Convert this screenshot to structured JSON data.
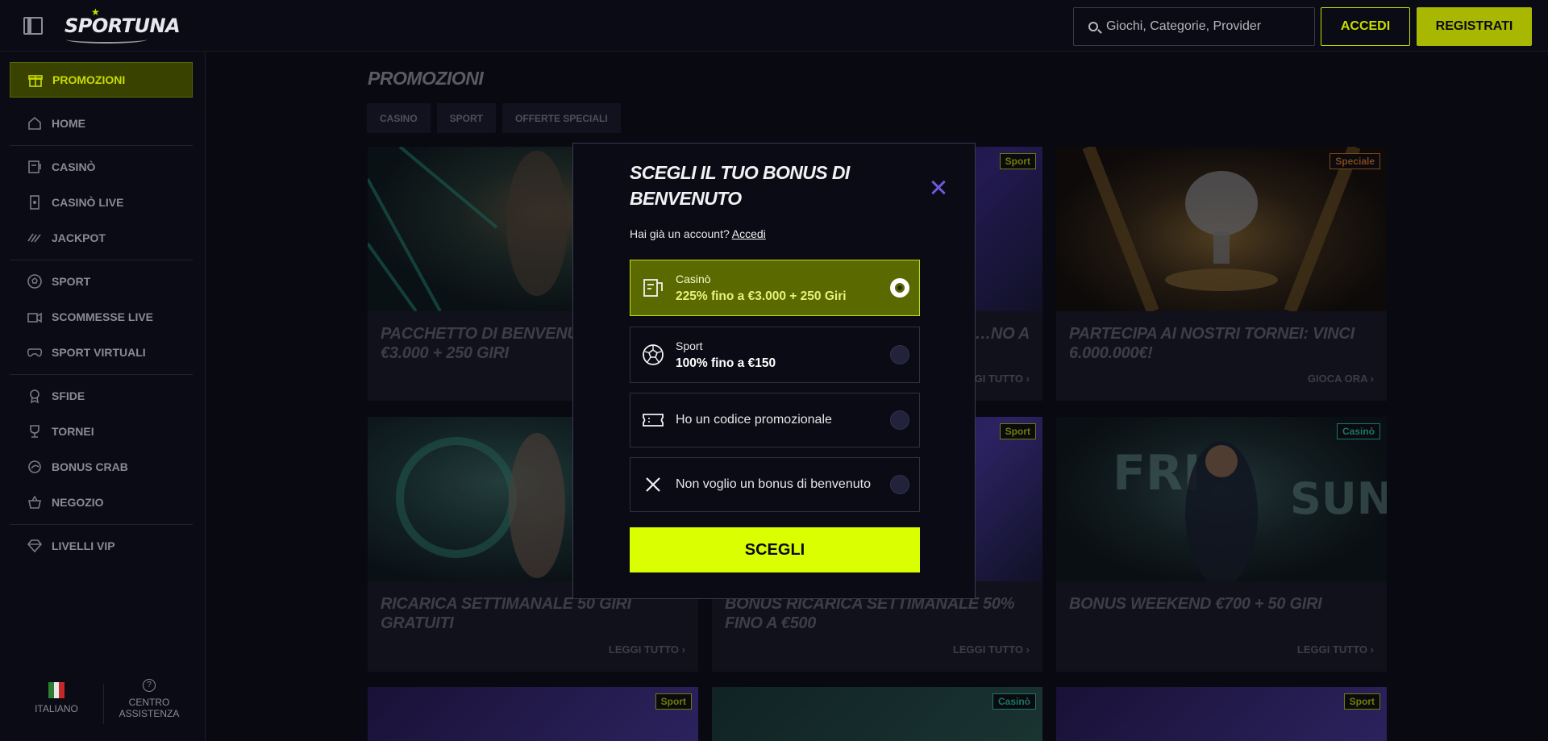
{
  "header": {
    "logo": "SPORTUNA",
    "search_placeholder": "Giochi, Categorie, Provider",
    "login_label": "ACCEDI",
    "register_label": "REGISTRATI"
  },
  "sidebar": {
    "items": [
      {
        "label": "PROMOZIONI",
        "icon": "gift-icon",
        "active": true
      },
      {
        "label": "HOME",
        "icon": "home-icon"
      },
      {
        "label": "CASINÒ",
        "icon": "casino-icon"
      },
      {
        "label": "CASINÒ LIVE",
        "icon": "live-casino-icon"
      },
      {
        "label": "JACKPOT",
        "icon": "jackpot-icon"
      },
      {
        "label": "SPORT",
        "icon": "soccer-ball-icon"
      },
      {
        "label": "SCOMMESSE LIVE",
        "icon": "live-camera-icon"
      },
      {
        "label": "SPORT VIRTUALI",
        "icon": "gamepad-icon"
      },
      {
        "label": "SFIDE",
        "icon": "medal-icon"
      },
      {
        "label": "TORNEI",
        "icon": "trophy-icon"
      },
      {
        "label": "BONUS CRAB",
        "icon": "crab-icon"
      },
      {
        "label": "NEGOZIO",
        "icon": "basket-icon"
      },
      {
        "label": "LIVELLI VIP",
        "icon": "diamond-icon"
      }
    ],
    "language_label": "ITALIANO",
    "help_line1": "CENTRO",
    "help_line2": "ASSISTENZA"
  },
  "main": {
    "title": "PROMOZIONI",
    "tabs": [
      "CASINO",
      "SPORT",
      "OFFERTE SPECIALI"
    ],
    "cards": [
      {
        "title": "PACCHETTO DI BENVENUTO FINO A €3.000 + 250 GIRI",
        "badge": "",
        "link": ""
      },
      {
        "title": "…NO A",
        "badge": "Sport",
        "link": "…GI TUTTO"
      },
      {
        "title": "PARTECIPA AI NOSTRI TORNEI: VINCI 6.000.000€!",
        "badge": "Speciale",
        "link": "GIOCA ORA"
      },
      {
        "title": "RICARICA SETTIMANALE 50 GIRI GRATUITI",
        "badge": "",
        "link": "LEGGI TUTTO"
      },
      {
        "title": "BONUS RICARICA SETTIMANALE 50% FINO A €500",
        "badge": "Sport",
        "link": "LEGGI TUTTO"
      },
      {
        "title": "BONUS WEEKEND €700 + 50 GIRI",
        "badge": "Casinò",
        "link": "LEGGI TUTTO"
      },
      {
        "title": "",
        "badge": "Sport",
        "link": ""
      },
      {
        "title": "",
        "badge": "Casinò",
        "link": ""
      },
      {
        "title": "",
        "badge": "Sport",
        "link": ""
      }
    ]
  },
  "modal": {
    "title": "SCEGLI IL TUO BONUS DI BENVENUTO",
    "login_prompt": "Hai già un account?",
    "login_link": "Accedi",
    "options": [
      {
        "small": "Casinò",
        "big": "225% fino a €3.000 + 250 Giri",
        "icon": "casino-icon",
        "selected": true
      },
      {
        "small": "Sport",
        "big": "100% fino a €150",
        "icon": "soccer-ball-icon",
        "selected": false
      },
      {
        "label": "Ho un codice promozionale",
        "icon": "ticket-icon",
        "selected": false
      },
      {
        "label": "Non voglio un bonus di benvenuto",
        "icon": "close-icon",
        "selected": false
      }
    ],
    "confirm_label": "SCEGLI"
  },
  "colors": {
    "accent": "#d9ff00",
    "accent_dark": "#a8b800",
    "background": "#0c0c16",
    "modal_close": "#6a5ad8"
  }
}
